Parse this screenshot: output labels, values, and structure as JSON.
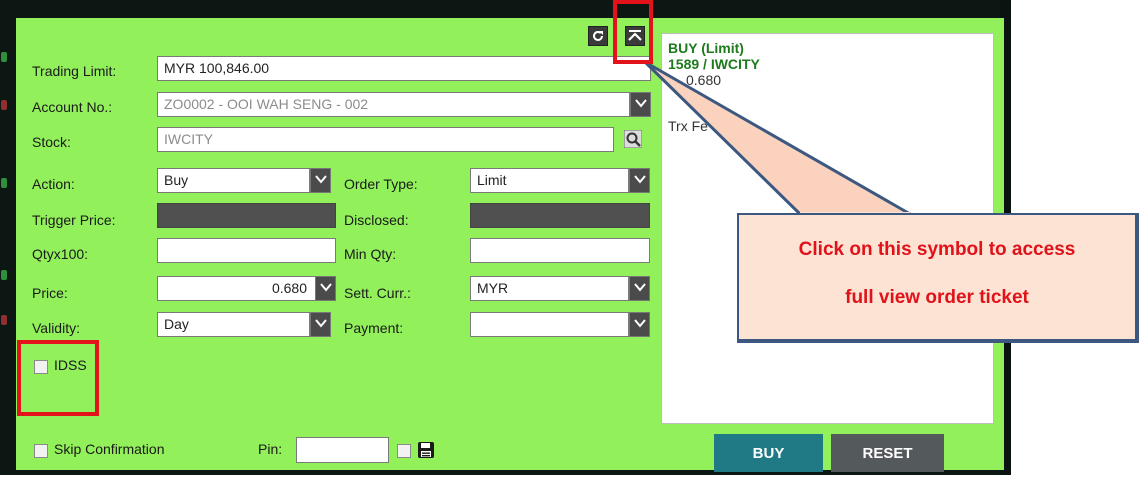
{
  "form": {
    "trading_limit": {
      "label": "Trading Limit:",
      "value": "MYR 100,846.00"
    },
    "account": {
      "label": "Account No.:",
      "value": "ZO0002 - OOI WAH SENG - 002"
    },
    "stock": {
      "label": "Stock:",
      "value": "IWCITY"
    },
    "action": {
      "label": "Action:",
      "value": "Buy"
    },
    "order_type": {
      "label": "Order Type:",
      "value": "Limit"
    },
    "trigger_price": {
      "label": "Trigger Price:"
    },
    "disclosed": {
      "label": "Disclosed:"
    },
    "qty": {
      "label": "Qtyx100:",
      "value": ""
    },
    "min_qty": {
      "label": "Min Qty:",
      "value": ""
    },
    "price": {
      "label": "Price:",
      "value": "0.680"
    },
    "sett_curr": {
      "label": "Sett. Curr.:",
      "value": "MYR"
    },
    "validity": {
      "label": "Validity:",
      "value": "Day"
    },
    "payment": {
      "label": "Payment:",
      "value": ""
    },
    "idss": {
      "label": "IDSS"
    },
    "skip_confirmation": {
      "label": "Skip Confirmation"
    },
    "pin": {
      "label": "Pin:",
      "value": ""
    }
  },
  "summary": {
    "line1": "BUY (Limit)",
    "line2": "1589 / IWCITY",
    "line3": "0.680",
    "line4": "Trx Fe"
  },
  "buttons": {
    "buy": "BUY",
    "reset": "RESET"
  },
  "callout": {
    "line1": "Click on this symbol to access",
    "line2": "full view order ticket"
  },
  "colors": {
    "panel": "#92f05b",
    "buy_button": "#1f7a86",
    "reset_button": "#54595c",
    "callout_text": "#e0121a",
    "summary_text": "#1d7a1d"
  },
  "icons": [
    "refresh-icon",
    "collapse-up-icon",
    "search-icon",
    "save-icon",
    "chevron-down-icon"
  ]
}
